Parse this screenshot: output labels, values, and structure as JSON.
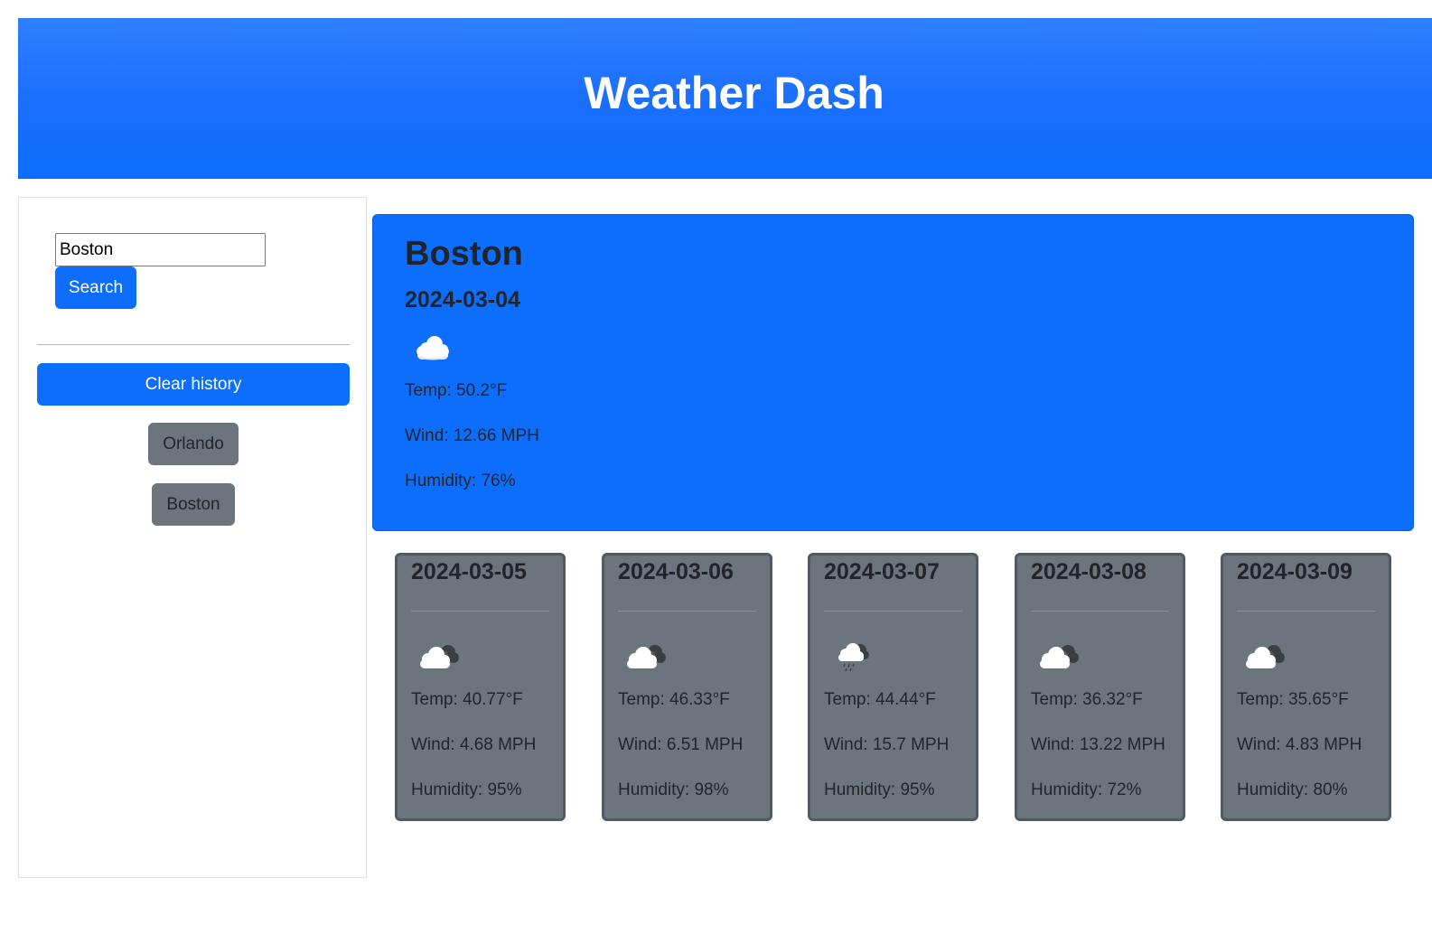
{
  "header": {
    "title": "Weather Dash"
  },
  "sidebar": {
    "search_value": "Boston",
    "search_label": "Search",
    "clear_label": "Clear history",
    "history": [
      "Orlando",
      "Boston"
    ]
  },
  "current": {
    "city": "Boston",
    "date": "2024-03-04",
    "icon": "cloud-icon",
    "temp": "Temp: 50.2°F",
    "wind": "Wind: 12.66 MPH",
    "humidity": "Humidity: 76%"
  },
  "forecast": [
    {
      "date": "2024-03-05",
      "icon": "broken-clouds-icon",
      "temp": "Temp: 40.77°F",
      "wind": "Wind: 4.68 MPH",
      "humidity": "Humidity: 95%"
    },
    {
      "date": "2024-03-06",
      "icon": "broken-clouds-icon",
      "temp": "Temp: 46.33°F",
      "wind": "Wind: 6.51 MPH",
      "humidity": "Humidity: 98%"
    },
    {
      "date": "2024-03-07",
      "icon": "rain-cloud-icon",
      "temp": "Temp: 44.44°F",
      "wind": "Wind: 15.7 MPH",
      "humidity": "Humidity: 95%"
    },
    {
      "date": "2024-03-08",
      "icon": "broken-clouds-icon",
      "temp": "Temp: 36.32°F",
      "wind": "Wind: 13.22 MPH",
      "humidity": "Humidity: 72%"
    },
    {
      "date": "2024-03-09",
      "icon": "broken-clouds-icon",
      "temp": "Temp: 35.65°F",
      "wind": "Wind: 4.83 MPH",
      "humidity": "Humidity: 80%"
    }
  ],
  "colors": {
    "primary": "#0d6efd",
    "secondary": "#6c757d"
  }
}
